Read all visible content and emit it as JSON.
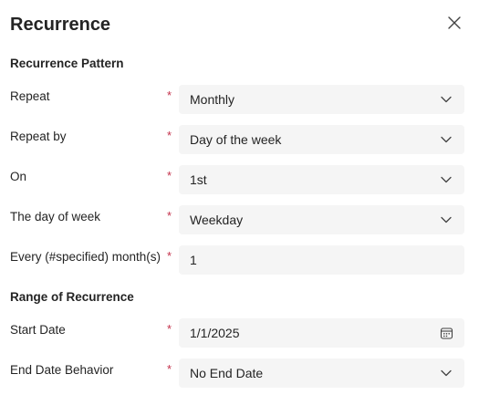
{
  "dialog": {
    "title": "Recurrence"
  },
  "pattern_section": {
    "heading": "Recurrence Pattern",
    "repeat": {
      "label": "Repeat",
      "required_mark": "*",
      "value": "Monthly"
    },
    "repeat_by": {
      "label": "Repeat by",
      "required_mark": "*",
      "value": "Day of the week"
    },
    "on": {
      "label": "On",
      "required_mark": "*",
      "value": "1st"
    },
    "day_of_week": {
      "label": "The day of week",
      "required_mark": "*",
      "value": "Weekday"
    },
    "every_months": {
      "label": "Every (#specified) month(s)",
      "required_mark": "*",
      "value": "1"
    }
  },
  "range_section": {
    "heading": "Range of Recurrence",
    "start_date": {
      "label": "Start Date",
      "required_mark": "*",
      "value": "1/1/2025"
    },
    "end_behavior": {
      "label": "End Date Behavior",
      "required_mark": "*",
      "value": "No End Date"
    }
  },
  "icons": {
    "close": "close-icon",
    "dropdown": "chevron-down-icon",
    "calendar": "calendar-icon"
  },
  "colors": {
    "required": "#c4314b",
    "field_bg": "#f5f5f5",
    "text": "#242424"
  }
}
